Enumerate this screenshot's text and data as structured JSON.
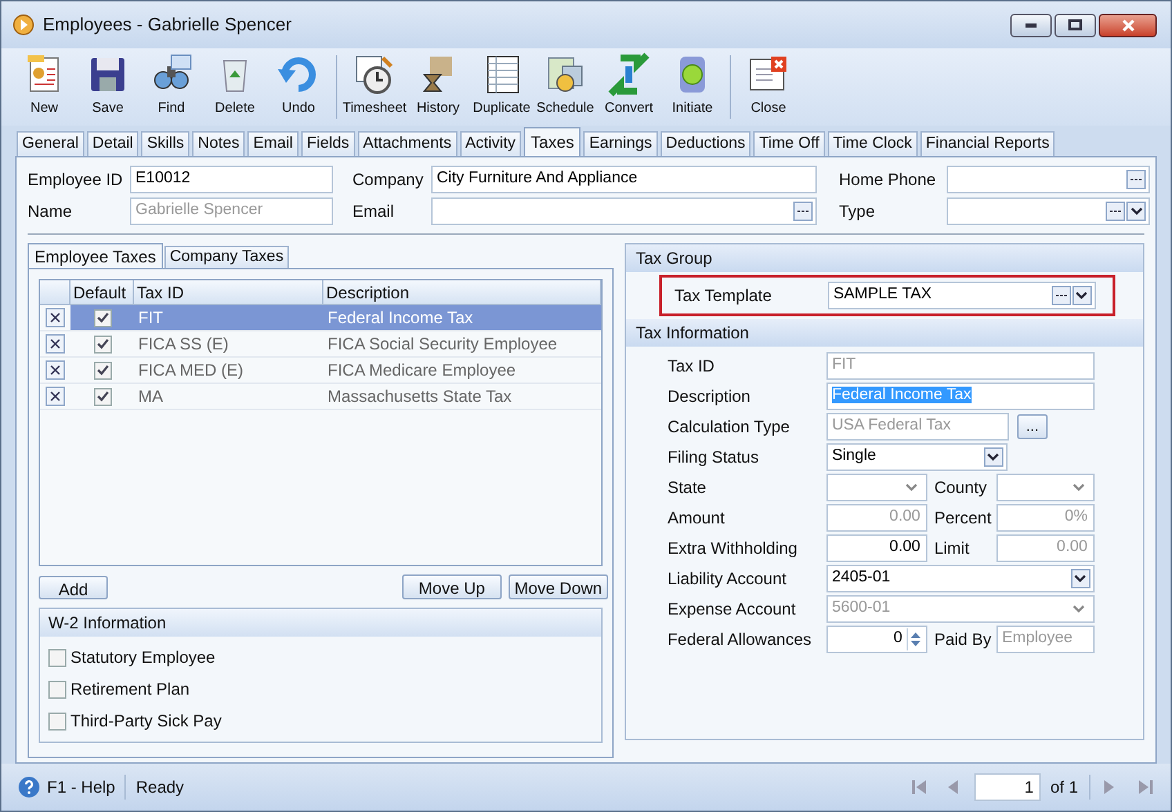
{
  "window": {
    "title": "Employees - Gabrielle Spencer"
  },
  "toolbar": {
    "groups": [
      [
        {
          "label": "New"
        },
        {
          "label": "Save"
        },
        {
          "label": "Find"
        },
        {
          "label": "Delete"
        },
        {
          "label": "Undo"
        }
      ],
      [
        {
          "label": "Timesheet"
        },
        {
          "label": "History"
        },
        {
          "label": "Duplicate"
        },
        {
          "label": "Schedule"
        },
        {
          "label": "Convert"
        },
        {
          "label": "Initiate"
        }
      ],
      [
        {
          "label": "Close"
        }
      ]
    ]
  },
  "tabs": [
    {
      "label": "General",
      "selected": false
    },
    {
      "label": "Detail",
      "selected": false
    },
    {
      "label": "Skills",
      "selected": false
    },
    {
      "label": "Notes",
      "selected": false
    },
    {
      "label": "Email",
      "selected": false
    },
    {
      "label": "Fields",
      "selected": false
    },
    {
      "label": "Attachments",
      "selected": false
    },
    {
      "label": "Activity",
      "selected": false
    },
    {
      "label": "Taxes",
      "selected": true
    },
    {
      "label": "Earnings",
      "selected": false
    },
    {
      "label": "Deductions",
      "selected": false
    },
    {
      "label": "Time Off",
      "selected": false
    },
    {
      "label": "Time Clock",
      "selected": false
    },
    {
      "label": "Financial Reports",
      "selected": false
    }
  ],
  "header": {
    "employee_id": {
      "label": "Employee ID",
      "value": "E10012",
      "disabled": false
    },
    "name": {
      "label": "Name",
      "value": "Gabrielle Spencer",
      "disabled": true
    },
    "company": {
      "label": "Company",
      "value": "City Furniture And Appliance"
    },
    "email": {
      "label": "Email"
    },
    "home_phone": {
      "label": "Home Phone"
    },
    "type": {
      "label": "Type"
    }
  },
  "sub_tabs": [
    {
      "label": "Employee Taxes",
      "selected": true
    },
    {
      "label": "Company Taxes",
      "selected": false
    }
  ],
  "grid": {
    "columns": [
      "Default",
      "Tax ID",
      "Description"
    ],
    "rows": [
      {
        "default": true,
        "tax_id": "FIT",
        "description": "Federal Income Tax",
        "selected": true
      },
      {
        "default": true,
        "tax_id": "FICA SS (E)",
        "description": "FICA Social Security Employee",
        "selected": false
      },
      {
        "default": true,
        "tax_id": "FICA MED (E)",
        "description": "FICA Medicare Employee",
        "selected": false
      },
      {
        "default": true,
        "tax_id": "MA",
        "description": "Massachusetts State Tax",
        "selected": false
      }
    ]
  },
  "grid_buttons": {
    "add": "Add",
    "move_up": "Move Up",
    "move_down": "Move Down"
  },
  "w2": {
    "title": "W-2 Information",
    "items": [
      {
        "label": "Statutory Employee",
        "checked": false
      },
      {
        "label": "Retirement Plan",
        "checked": false
      },
      {
        "label": "Third-Party Sick Pay",
        "checked": false
      }
    ]
  },
  "tax_group": {
    "title": "Tax Group",
    "template": {
      "label": "Tax Template",
      "value": "SAMPLE TAX",
      "highlighted": true
    }
  },
  "tax_information": {
    "title": "Tax Information",
    "rows": [
      {
        "fields": [
          {
            "kind": "text",
            "label": "Tax ID",
            "value": "FIT",
            "disabled": true
          }
        ]
      },
      {
        "fields": [
          {
            "kind": "text",
            "label": "Description",
            "value": "Federal Income Tax",
            "text_selected": true
          }
        ]
      },
      {
        "fields": [
          {
            "kind": "lookup",
            "label": "Calculation Type",
            "value": "USA Federal Tax",
            "disabled": true,
            "button": "..."
          }
        ]
      },
      {
        "fields": [
          {
            "kind": "combo",
            "label": "Filing Status",
            "value": "Single",
            "disabled": false
          }
        ]
      },
      {
        "fields": [
          {
            "kind": "combo",
            "label": "State",
            "disabled": true
          },
          {
            "kind": "combo",
            "label": "County",
            "disabled": true
          }
        ]
      },
      {
        "fields": [
          {
            "kind": "number",
            "label": "Amount",
            "value": "0.00",
            "disabled": true
          },
          {
            "kind": "number",
            "label": "Percent",
            "value": "0%",
            "disabled": true
          }
        ]
      },
      {
        "fields": [
          {
            "kind": "number",
            "label": "Extra Withholding",
            "value": "0.00",
            "disabled": false
          },
          {
            "kind": "number",
            "label": "Limit",
            "value": "0.00",
            "disabled": true
          }
        ]
      },
      {
        "fields": [
          {
            "kind": "combo",
            "label": "Liability Account",
            "value": "2405-01",
            "disabled": false
          }
        ]
      },
      {
        "fields": [
          {
            "kind": "combo",
            "label": "Expense Account",
            "value": "5600-01",
            "disabled": true
          }
        ]
      },
      {
        "fields": [
          {
            "kind": "spinner",
            "label": "Federal Allowances",
            "value": "0",
            "disabled": false
          },
          {
            "kind": "text",
            "label": "Paid By",
            "value": "Employee",
            "disabled": true
          }
        ]
      }
    ]
  },
  "status_bar": {
    "help": "F1 - Help",
    "status": "Ready",
    "pager": {
      "page": "1",
      "of": "of",
      "total": "1"
    }
  }
}
